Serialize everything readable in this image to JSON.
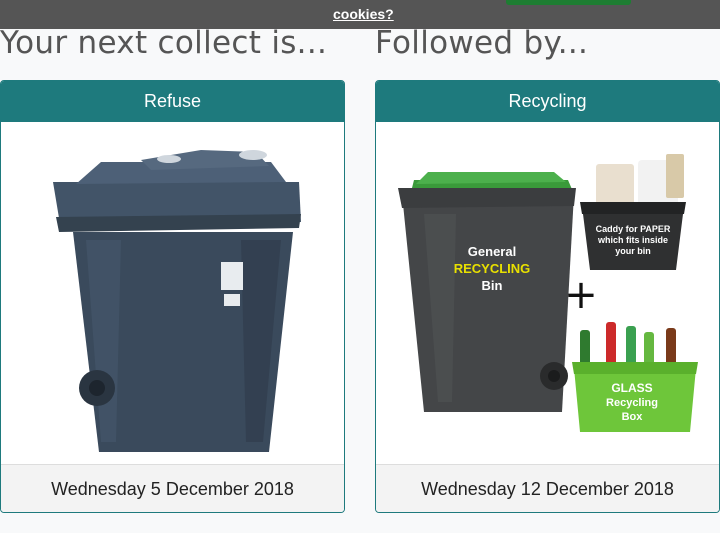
{
  "cookie_banner": {
    "link_text": "cookies?"
  },
  "headings": {
    "next": "Your next collect is...",
    "followed": "Followed by..."
  },
  "cards": [
    {
      "title": "Refuse",
      "date": "Wednesday 5 December 2018",
      "image": "refuse-bin-icon"
    },
    {
      "title": "Recycling",
      "date": "Wednesday 12 December 2018",
      "image": "recycling-bins-icon",
      "image_text": {
        "bin_line1": "General",
        "bin_line2": "RECYCLING",
        "bin_line3": "Bin",
        "caddy_line1": "Caddy for PAPER",
        "caddy_line2": "which fits inside",
        "caddy_line3": "your bin",
        "plus": "+",
        "glass_line1": "GLASS",
        "glass_line2": "Recycling",
        "glass_line3": "Box"
      }
    }
  ],
  "colors": {
    "teal": "#1e7a7d",
    "bin_grey": "#3a4a5c",
    "recycling_lid": "#3a9a3a",
    "glass_box": "#6ec63a",
    "recycling_yellow": "#e8e000"
  }
}
